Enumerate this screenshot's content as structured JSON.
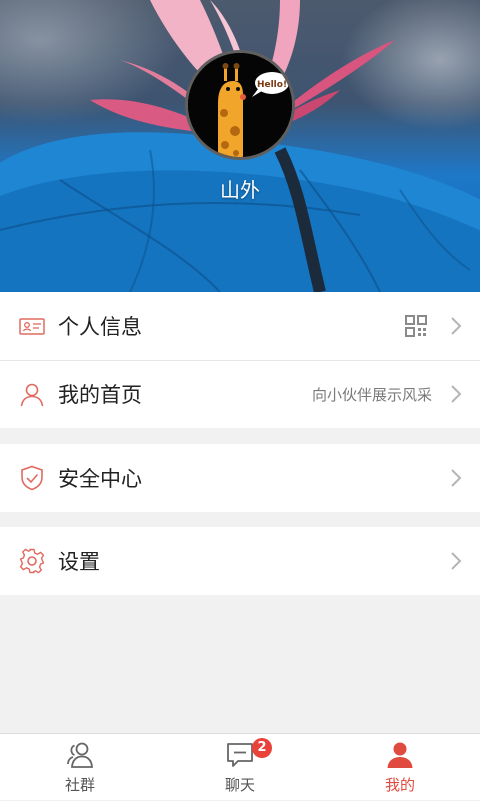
{
  "profile": {
    "username": "山外",
    "avatar_text": "Hello!"
  },
  "menu": {
    "group1": [
      {
        "label": "个人信息",
        "icon": "id-card-icon",
        "right": "qr-code-icon"
      },
      {
        "label": "我的首页",
        "icon": "user-icon",
        "hint": "向小伙伴展示风采"
      }
    ],
    "group2": [
      {
        "label": "安全中心",
        "icon": "shield-check-icon"
      }
    ],
    "group3": [
      {
        "label": "设置",
        "icon": "gear-icon"
      }
    ]
  },
  "tabs": [
    {
      "label": "社群",
      "icon": "group-icon",
      "active": false
    },
    {
      "label": "聊天",
      "icon": "chat-icon",
      "badge": "2",
      "active": false
    },
    {
      "label": "我的",
      "icon": "person-icon",
      "active": true
    }
  ],
  "colors": {
    "accent": "#e04a3f",
    "badge": "#e8423a",
    "icon_outline": "#e06a60"
  }
}
